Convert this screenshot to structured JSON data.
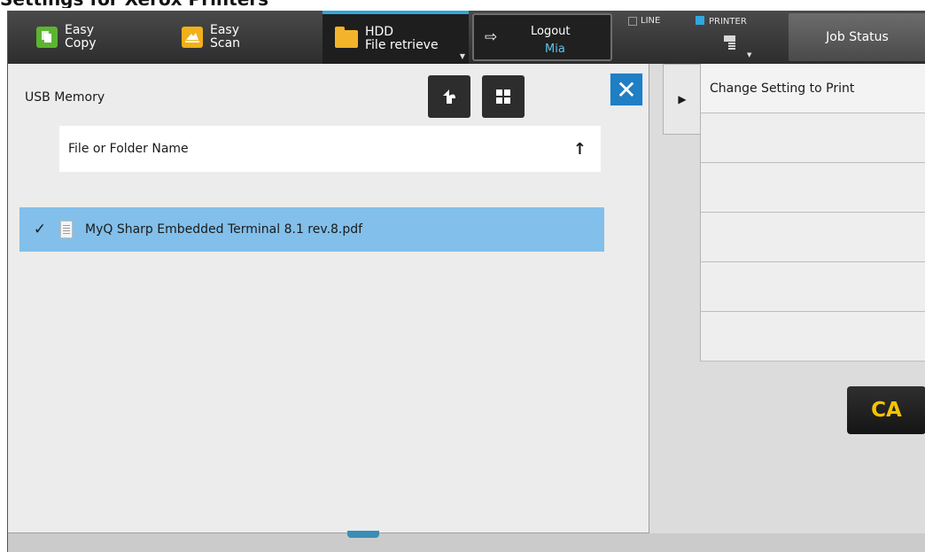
{
  "caption": "Settings for Xerox Printers",
  "topbar": {
    "easy_copy": {
      "line1": "Easy",
      "line2": "Copy",
      "icon": "copy-icon"
    },
    "easy_scan": {
      "line1": "Easy",
      "line2": "Scan",
      "icon": "scan-icon"
    },
    "hdd": {
      "line1": "HDD",
      "line2": "File retrieve",
      "icon": "folder-icon"
    },
    "logout": {
      "label": "Logout",
      "user": "Mia",
      "icon": "logout-arrow-icon"
    },
    "line_label": "LINE",
    "printer_label": "PRINTER",
    "job_status": "Job Status",
    "accent_color": "#32a6d9"
  },
  "left_panel": {
    "location": "USB Memory",
    "up_icon": "back-up-arrow-icon",
    "grid_icon": "grid-view-icon",
    "close_icon": "close-x-icon",
    "column_header": "File or Folder Name",
    "sort_icon": "sort-ascending-arrow-icon",
    "files": [
      {
        "name": "MyQ Sharp Embedded Terminal 8.1 rev.8.pdf",
        "selected": true,
        "icon": "document-icon"
      }
    ],
    "selection_color": "#82bfea"
  },
  "right_panel": {
    "items": [
      "Change Setting to Print",
      "",
      "",
      "",
      "",
      ""
    ],
    "expand_icon": "expand-right-icon",
    "clear_all": "CA",
    "clear_all_color": "#f5c400"
  }
}
